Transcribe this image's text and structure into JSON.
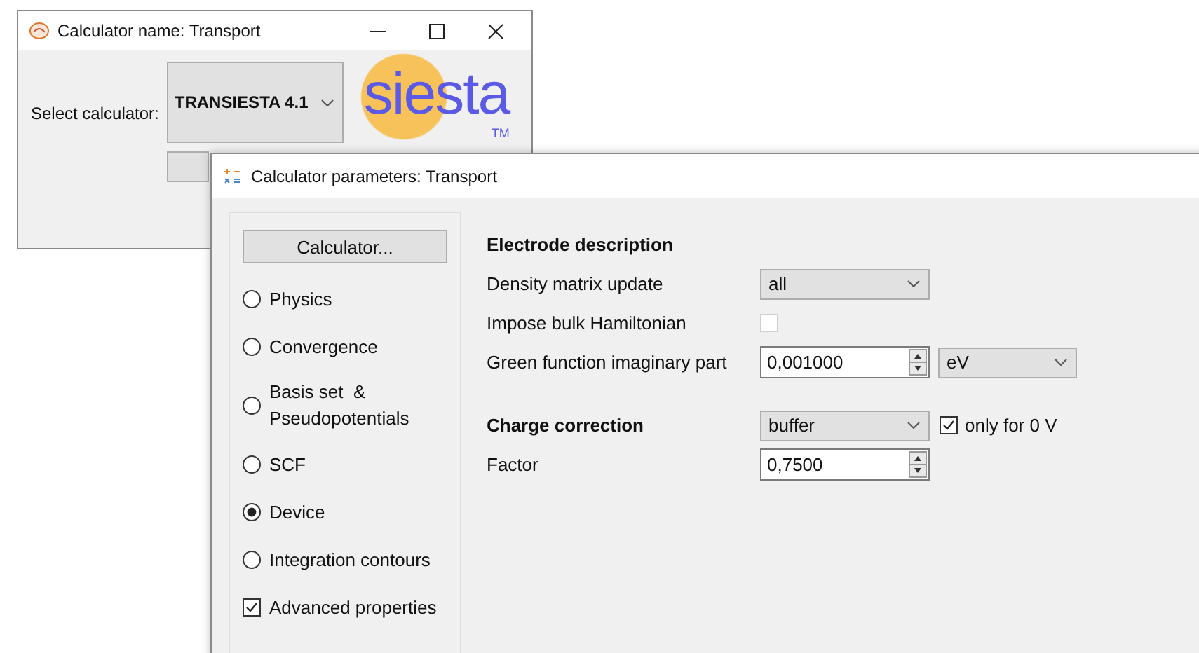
{
  "main_window": {
    "title": "Calculator name: Transport",
    "select_label": "Select calculator:",
    "calculator": {
      "value": "TRANSIESTA 4.1"
    },
    "logo": {
      "text": "siesta",
      "mark": "TM"
    }
  },
  "params_window": {
    "title": "Calculator parameters: Transport",
    "calculator_button": "Calculator...",
    "sections": [
      {
        "kind": "radio",
        "label": "Physics",
        "selected": false
      },
      {
        "kind": "radio",
        "label": "Convergence",
        "selected": false
      },
      {
        "kind": "radio",
        "label": "Basis set  &\nPseudopotentials",
        "selected": false
      },
      {
        "kind": "radio",
        "label": "SCF",
        "selected": false
      },
      {
        "kind": "radio",
        "label": "Device",
        "selected": true
      },
      {
        "kind": "radio",
        "label": "Integration contours",
        "selected": false
      },
      {
        "kind": "checkbox",
        "label": "Advanced properties",
        "checked": true
      }
    ],
    "groups": [
      {
        "rows": [
          {
            "kind": "heading",
            "label": "Electrode description"
          },
          {
            "kind": "combo",
            "label": "Density matrix update",
            "value": "all"
          },
          {
            "kind": "checkbox",
            "label": "Impose bulk Hamiltonian",
            "checked": false
          },
          {
            "kind": "spin",
            "label": "Green function imaginary part",
            "value": "0,001000",
            "unit": "eV"
          }
        ]
      },
      {
        "rows": [
          {
            "kind": "combo",
            "label": "Charge correction",
            "bold": true,
            "value": "buffer",
            "option": {
              "label": "only for 0 V",
              "checked": true
            }
          },
          {
            "kind": "spin",
            "label": "Factor",
            "value": "0,7500"
          }
        ]
      }
    ]
  }
}
